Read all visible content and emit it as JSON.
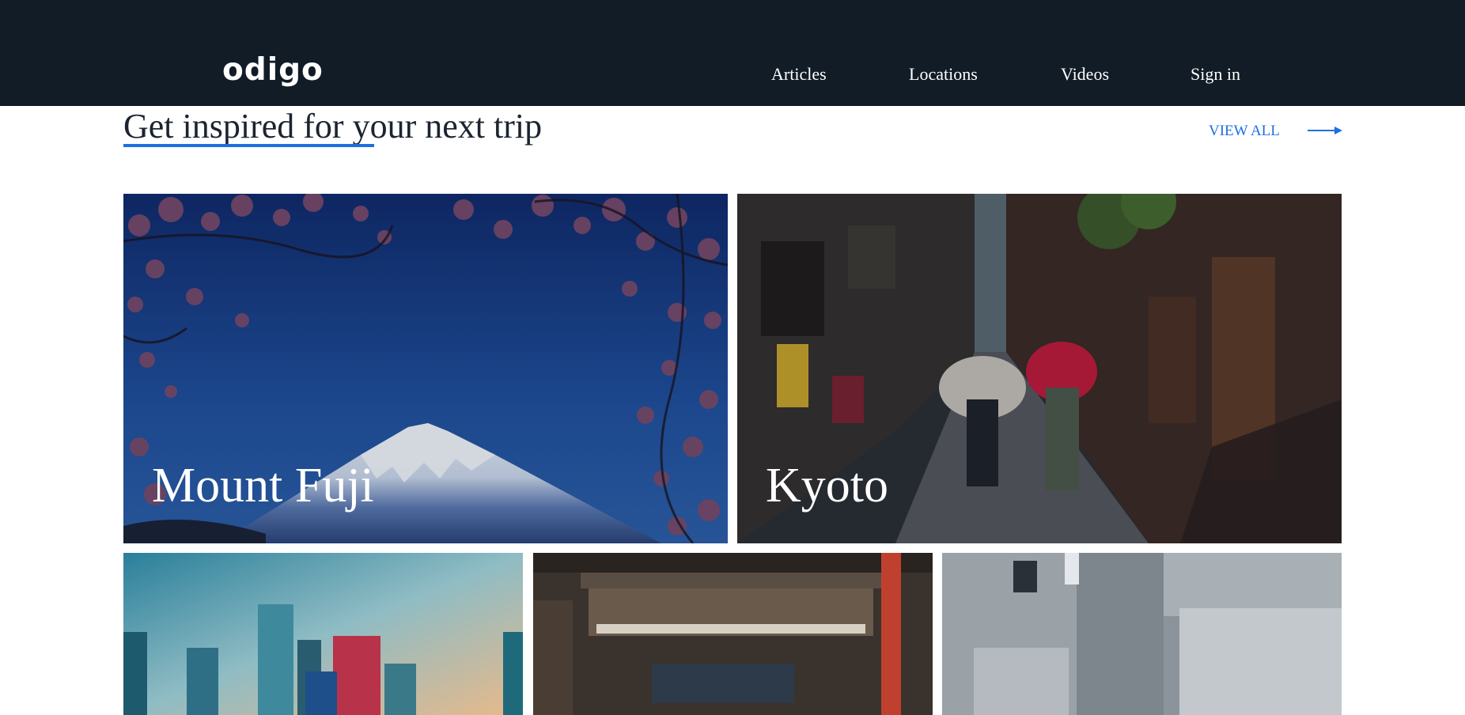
{
  "header": {
    "logo": "odigo",
    "nav": {
      "articles": "Articles",
      "locations": "Locations",
      "videos": "Videos",
      "sign_in": "Sign in"
    }
  },
  "section": {
    "title": "Get inspired for your next trip",
    "view_all": "VIEW ALL",
    "view_all_icon": "arrow-right-icon"
  },
  "cards": [
    {
      "label": "Mount Fuji"
    },
    {
      "label": "Kyoto"
    },
    {
      "label": ""
    },
    {
      "label": ""
    },
    {
      "label": ""
    }
  ],
  "colors": {
    "header_bg": "#111c27",
    "accent": "#1e6fe0",
    "text_dark": "#1b2430"
  }
}
